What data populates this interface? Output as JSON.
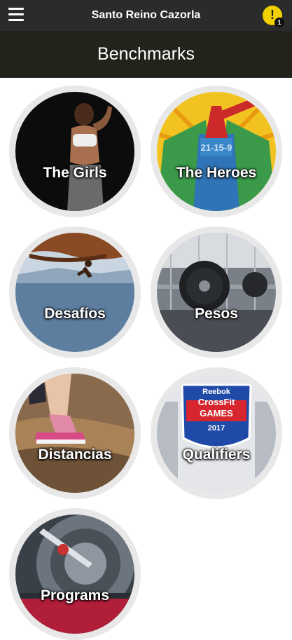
{
  "header": {
    "app_title": "Santo Reino Cazorla",
    "menu_icon": "hamburger-menu-icon",
    "alert_icon": "exclamation-alert-icon",
    "alert_count": "1",
    "accent_color": "#f0d000"
  },
  "section": {
    "title": "Benchmarks"
  },
  "tiles": [
    {
      "label": "The Girls"
    },
    {
      "label": "The Heroes"
    },
    {
      "label": "Desafíos"
    },
    {
      "label": "Pesos"
    },
    {
      "label": "Distancias"
    },
    {
      "label": "Qualifiers",
      "badge_lines": [
        "Reebok",
        "CrossFit",
        "GAMES",
        "2017"
      ]
    },
    {
      "label": "Programs"
    }
  ]
}
